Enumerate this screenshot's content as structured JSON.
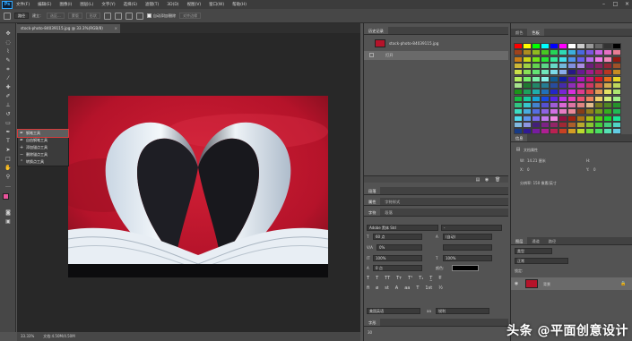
{
  "menubar": {
    "app_logo": "Ps",
    "items": [
      "文件(F)",
      "编辑(E)",
      "图像(I)",
      "图层(L)",
      "文字(Y)",
      "选择(S)",
      "滤镜(T)",
      "3D(D)",
      "视图(V)",
      "窗口(W)",
      "帮助(H)"
    ],
    "window_controls": [
      "–",
      "□",
      "×"
    ]
  },
  "options_bar": {
    "mode_value": "路径",
    "make_label": "建立：",
    "selection_button": "选区...",
    "mask_button": "蒙版",
    "shape_button": "形状",
    "auto_add_delete": "自动添加/删除",
    "align_edges": "对齐边缘"
  },
  "document": {
    "tab_title": "stock-photo-84039115.jpg @ 33.3%(RGB/8)",
    "zoom": "33.33%",
    "doc_size": "文档:4.50M/4.50M"
  },
  "tool_flyout": {
    "items": [
      {
        "label": "钢笔工具",
        "shortcut": "P",
        "selected": true
      },
      {
        "label": "自由钢笔工具",
        "shortcut": "P",
        "selected": false
      },
      {
        "label": "添加锚点工具",
        "shortcut": "",
        "selected": false
      },
      {
        "label": "删除锚点工具",
        "shortcut": "",
        "selected": false
      },
      {
        "label": "转换点工具",
        "shortcut": "",
        "selected": false
      }
    ]
  },
  "history_panel": {
    "tab": "历史记录",
    "snapshot_name": "stock-photo-84039115.jpg",
    "state_open": "打开"
  },
  "char_panels": {
    "tabs_top": [
      "段落"
    ],
    "tabs_mid": [
      "属性",
      "字符样式"
    ],
    "tabs_char": [
      "字符",
      "段落"
    ],
    "font_family": "Adobe 黑体 Std",
    "font_style": "-",
    "font_size": "60 点",
    "leading": "(自动)",
    "kerning": "0%",
    "tracking": "",
    "vscale": "100%",
    "hscale": "100%",
    "baseline": "0 点",
    "color_label": "颜色:",
    "language": "美国英语",
    "antialias": "锐利",
    "bottom_tab": "字形",
    "bottom_value": "30"
  },
  "swatches_panel": {
    "tabs": [
      "颜色",
      "色板"
    ]
  },
  "info_panel": {
    "tab": "信息",
    "doc_props_label": "文档属性",
    "w_label": "W:",
    "w_value": "14.21 厘米",
    "x_label": "X:",
    "x_value": "0",
    "h_label": "H:",
    "y_label": "Y:",
    "y_value": "0",
    "resolution": "分辨率: 150 像素/英寸"
  },
  "layers_panel": {
    "tabs": [
      "图层",
      "通道",
      "路径"
    ],
    "kind_label": "类型",
    "blend_label": "正常",
    "lock_label": "锁定:",
    "layer_name": "背景"
  },
  "watermark": "头条 @平面创意设计",
  "colors": {
    "photo_red": "#c1182b",
    "flyout_highlight": "#d63b3b",
    "fg_color": "#e9539c",
    "bg_color": "#ffffff"
  }
}
